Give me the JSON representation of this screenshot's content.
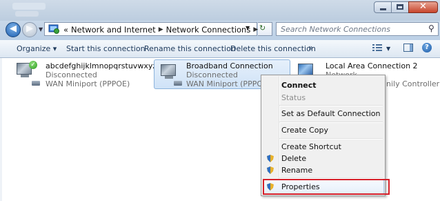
{
  "address_bar": {
    "chevrons": "«",
    "crumbs": [
      "Network and Internet",
      "Network Connections"
    ],
    "search_placeholder": "Search Network Connections"
  },
  "toolbar": {
    "organize": "Organize ▾",
    "start": "Start this connection",
    "rename": "Rename this connection",
    "delete": "Delete this connection",
    "more": "»"
  },
  "connections": [
    {
      "name": "abcdefghijklmnopqrstuvwxyz",
      "status": "Disconnected",
      "device": "WAN Miniport (PPPOE)"
    },
    {
      "name": "Broadband Connection",
      "status": "Disconnected",
      "device": "WAN Miniport (PPPOE)"
    },
    {
      "name": "Local Area Connection 2",
      "status": "Network",
      "device": "nily Controller"
    }
  ],
  "context_menu": {
    "connect": "Connect",
    "status": "Status",
    "set_default": "Set as Default Connection",
    "create_copy": "Create Copy",
    "create_shortcut": "Create Shortcut",
    "delete": "Delete",
    "rename": "Rename",
    "properties": "Properties"
  },
  "colors": {
    "selection_border": "#8cb3dc",
    "highlight_box": "#d6202a",
    "link_text": "#1e395b"
  },
  "icons": [
    "back-icon",
    "forward-icon",
    "refresh-icon",
    "search-icon",
    "help-icon",
    "shield-icon",
    "network-monitor-icon"
  ]
}
